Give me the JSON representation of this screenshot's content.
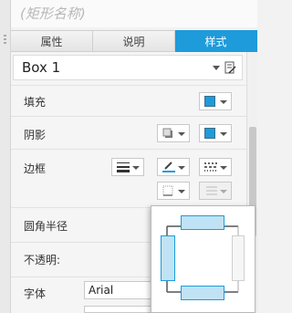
{
  "title": {
    "text": "(矩形名称)"
  },
  "tabs": [
    {
      "label": "属性",
      "active": false
    },
    {
      "label": "说明",
      "active": false
    },
    {
      "label": "样式",
      "active": true
    }
  ],
  "name_field": {
    "value": "Box 1"
  },
  "rows": {
    "fill": {
      "label": "填充"
    },
    "shadow": {
      "label": "阴影"
    },
    "border": {
      "label": "边框"
    },
    "corner_radius": {
      "label": "圆角半径"
    },
    "opacity": {
      "label": "不透明:"
    },
    "font": {
      "label": "字体",
      "value": "Arial"
    }
  },
  "colors": {
    "accent": "#1e9bdb",
    "popup_highlight": "#bfe3f4"
  },
  "icons": {
    "fill_color": "fill-color-icon",
    "shadow_style": "shadow-style-icon",
    "shadow_color": "shadow-color-icon",
    "line_width": "line-width-icon",
    "line_color": "pen-color-icon",
    "line_pattern": "dashed-line-icon",
    "visible_borders": "visible-borders-icon",
    "arrow_style": "arrow-style-icon"
  }
}
